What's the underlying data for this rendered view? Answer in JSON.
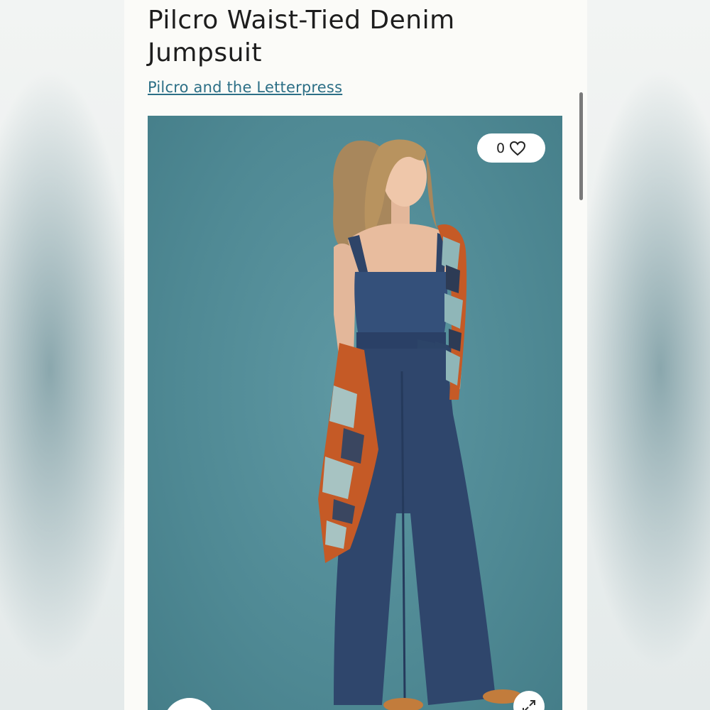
{
  "product": {
    "title": "Pilcro Waist-Tied Denim Jumpsuit",
    "brand": "Pilcro and the Letterpress"
  },
  "image": {
    "subject": "model wearing dark denim wide-leg jumpsuit with printed scarf",
    "favorites_count": "0",
    "favorite_icon": "heart-icon",
    "expand_icon": "expand-arrows-icon"
  },
  "colors": {
    "brand_link": "#2c6f86",
    "photo_background": "#528b96",
    "denim": "#2e4468",
    "scarf_orange": "#c55a26"
  }
}
